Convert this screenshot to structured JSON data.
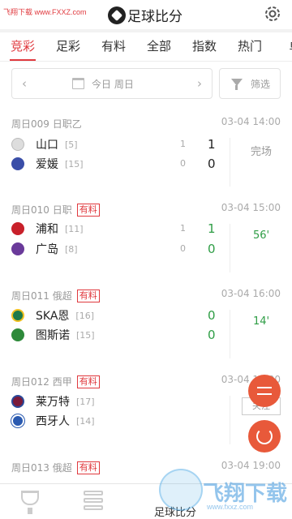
{
  "header": {
    "watermark": "飞翔下载 www.FXXZ.com",
    "title": "足球比分"
  },
  "tabs": [
    {
      "label": "竞彩",
      "active": true
    },
    {
      "label": "足彩"
    },
    {
      "label": "有料"
    },
    {
      "label": "全部"
    },
    {
      "label": "指数"
    },
    {
      "label": "热门"
    },
    {
      "label": "单"
    }
  ],
  "datebar": {
    "prev": "‹",
    "next": "›",
    "date_text": "今日 周日",
    "filter_label": "筛选"
  },
  "matches": [
    {
      "code": "周日009",
      "league": "日职乙",
      "tag": "",
      "time": "03-04 14:00",
      "home": {
        "name": "山口",
        "rank": "[5]",
        "aux": "1",
        "score": "1"
      },
      "away": {
        "name": "爱媛",
        "rank": "[15]",
        "aux": "0",
        "score": "0"
      },
      "status": "完场",
      "live": false
    },
    {
      "code": "周日010",
      "league": "日职",
      "tag": "有料",
      "time": "03-04 15:00",
      "home": {
        "name": "浦和",
        "rank": "[11]",
        "aux": "1",
        "score": "1"
      },
      "away": {
        "name": "广岛",
        "rank": "[8]",
        "aux": "0",
        "score": "0"
      },
      "status": "56'",
      "live": true
    },
    {
      "code": "周日011",
      "league": "俄超",
      "tag": "有料",
      "time": "03-04 16:00",
      "home": {
        "name": "SKA恩",
        "rank": "[16]",
        "aux": "",
        "score": "0"
      },
      "away": {
        "name": "图斯诺",
        "rank": "[15]",
        "aux": "",
        "score": "0"
      },
      "status": "14'",
      "live": true
    },
    {
      "code": "周日012",
      "league": "西甲",
      "tag": "有料",
      "time": "03-04 19:00",
      "home": {
        "name": "莱万特",
        "rank": "[17]",
        "aux": "",
        "score": ""
      },
      "away": {
        "name": "西牙人",
        "rank": "[14]",
        "aux": "",
        "score": ""
      },
      "status": "",
      "live": false
    },
    {
      "code": "周日013",
      "league": "俄超",
      "tag": "有料",
      "time": "03-04 19:00"
    }
  ],
  "follow_label": "关注",
  "bottom_nav": {
    "label": "足球比分"
  },
  "watermark_brand": {
    "text": "飞翔下载",
    "sub": "www.fxxz.com"
  },
  "colors": {
    "accent": "#e0393e",
    "live": "#2e9d45",
    "fab": "#e8593a"
  }
}
